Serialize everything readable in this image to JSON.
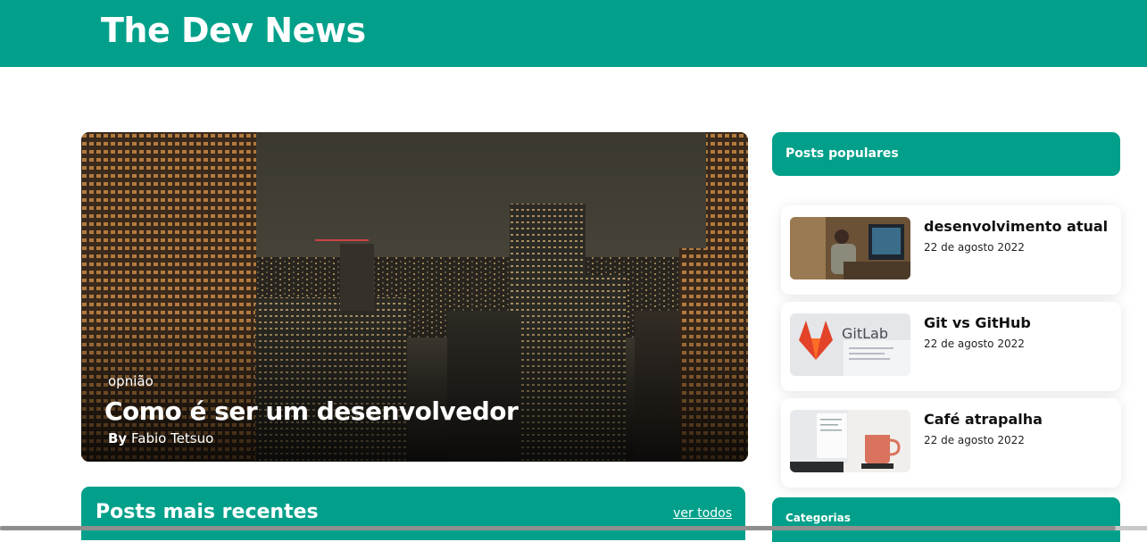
{
  "header": {
    "site_title": "The Dev News"
  },
  "hero": {
    "category": "opnião",
    "title": "Como é ser um desenvolvedor",
    "byline_prefix": "By",
    "author": "Fabio Tetsuo"
  },
  "recent": {
    "title": "Posts mais recentes",
    "see_all": "ver todos"
  },
  "sidebar": {
    "popular_title": "Posts populares",
    "posts": [
      {
        "title": "desenvolvimento atual",
        "date": "22 de agosto 2022",
        "thumb": "developer-at-desk-image"
      },
      {
        "title": "Git vs GitHub",
        "date": "22 de agosto 2022",
        "thumb": "gitlab-logo-image"
      },
      {
        "title": "Café atrapalha",
        "date": "22 de agosto 2022",
        "thumb": "coffee-mug-image"
      }
    ],
    "categories_title": "Categorias"
  },
  "colors": {
    "brand": "#02a08a",
    "text": "#111111",
    "white": "#ffffff"
  }
}
